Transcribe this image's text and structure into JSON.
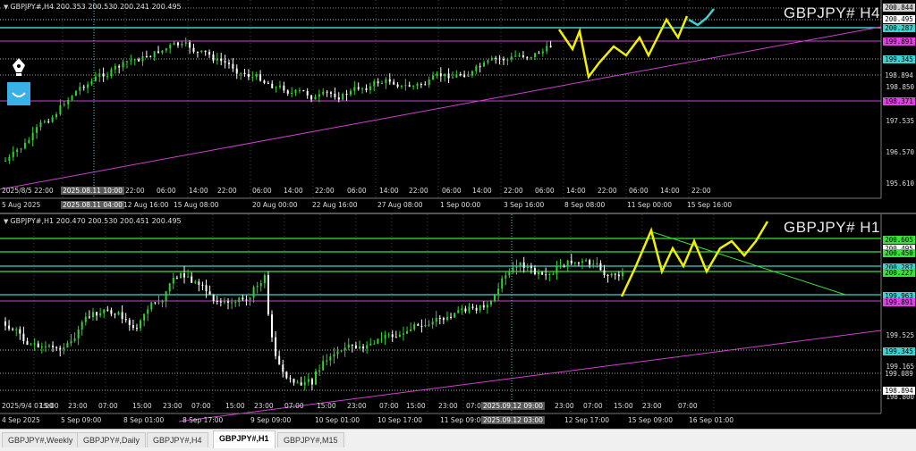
{
  "top": {
    "ohlc": "GBPJPY#,H4  200.353 200.530 200.241 200.495",
    "title": "GBPJPY# H4",
    "price_tags": [
      {
        "text": "200.844",
        "bg": "#cfcfcf",
        "fg": "#000"
      },
      {
        "text": "200.495",
        "bg": "#ffffff",
        "fg": "#000"
      },
      {
        "text": "200.287",
        "bg": "#3fd0d0",
        "fg": "#000"
      },
      {
        "text": "199.891",
        "bg": "#e040e0",
        "fg": "#000"
      },
      {
        "text": "199.345",
        "bg": "#3fd0d0",
        "fg": "#000"
      },
      {
        "text": "198.894",
        "bg": "#000",
        "fg": "#ddd"
      },
      {
        "text": "198.371",
        "bg": "#e040e0",
        "fg": "#000"
      }
    ],
    "price_labels": [
      "198.850",
      "197.535",
      "196.570",
      "195.610"
    ],
    "time_labels": [
      "5 Aug 2025",
      "2025.08.11 04:00",
      "12 Aug 16:00",
      "15 Aug 08:00",
      "20 Aug 00:00",
      "22 Aug 16:00",
      "27 Aug 08:00",
      "1 Sep 00:00",
      "3 Sep 16:00",
      "8 Sep 08:00",
      "11 Sep 00:00",
      "15 Sep 16:00"
    ],
    "cursor_labels": [
      "2025/8/5 22:00",
      "2025.08.11 10:00",
      "22:00",
      "06:00",
      "14:00",
      "22:00",
      "06:00",
      "14:00",
      "22:00",
      "06:00",
      "14:00",
      "22:00",
      "06:00",
      "14:00",
      "22:00",
      "06:00",
      "14:00",
      "22:00",
      "06:00",
      "14:00",
      "22:00"
    ]
  },
  "bottom": {
    "ohlc": "GBPJPY#,H1  200.470 200.530 200.451 200.495",
    "title": "GBPJPY# H1",
    "price_tags": [
      {
        "text": "200.605",
        "bg": "#3ce03c",
        "fg": "#000"
      },
      {
        "text": "200.495",
        "bg": "#ffffff",
        "fg": "#000"
      },
      {
        "text": "200.450",
        "bg": "#3ce03c",
        "fg": "#000"
      },
      {
        "text": "200.287",
        "bg": "#3fd0d0",
        "fg": "#000"
      },
      {
        "text": "200.227",
        "bg": "#3ce03c",
        "fg": "#000"
      },
      {
        "text": "199.963",
        "bg": "#3fd0d0",
        "fg": "#000"
      },
      {
        "text": "199.891",
        "bg": "#e040e0",
        "fg": "#000"
      },
      {
        "text": "199.345",
        "bg": "#3fd0d0",
        "fg": "#000"
      },
      {
        "text": "199.089",
        "bg": "#000",
        "fg": "#ddd"
      },
      {
        "text": "198.894",
        "bg": "#ffffff",
        "fg": "#000"
      }
    ],
    "price_labels": [
      "199.525",
      "199.165",
      "198.800"
    ],
    "time_labels": [
      "4 Sep 2025",
      "5 Sep 09:00",
      "8 Sep 01:00",
      "8 Sep 17:00",
      "9 Sep 09:00",
      "10 Sep 01:00",
      "10 Sep 17:00",
      "11 Sep 09:00",
      "2025.09.12 03:00",
      "12 Sep 17:00",
      "15 Sep 09:00",
      "16 Sep 01:00"
    ],
    "cursor_labels": [
      "2025/9/4 07:00",
      "15:00",
      "23:00",
      "07:00",
      "15:00",
      "23:00",
      "07:00",
      "15:00",
      "23:00",
      "07:00",
      "15:00",
      "23:00",
      "07:00",
      "15:00",
      "23:00",
      "07:00",
      "15:00",
      "2025.09.12 09:00",
      "23:00",
      "07:00",
      "15:00",
      "23:00",
      "07:00"
    ]
  },
  "tabs": [
    "GBPJPY#,Weekly",
    "GBPJPY#,Daily",
    "GBPJPY#,H4",
    "GBPJPY#,H1",
    "GBPJPY#,M15"
  ],
  "active_tab": "GBPJPY#,H1",
  "icons": [
    "pen-nib-icon",
    "smile-icon"
  ],
  "colors": {
    "bull": "#32d232",
    "bear": "#ffffff",
    "cyan": "#3fd0d0",
    "magenta": "#d040d0",
    "yellow": "#f0f000",
    "green": "#3ce03c"
  }
}
